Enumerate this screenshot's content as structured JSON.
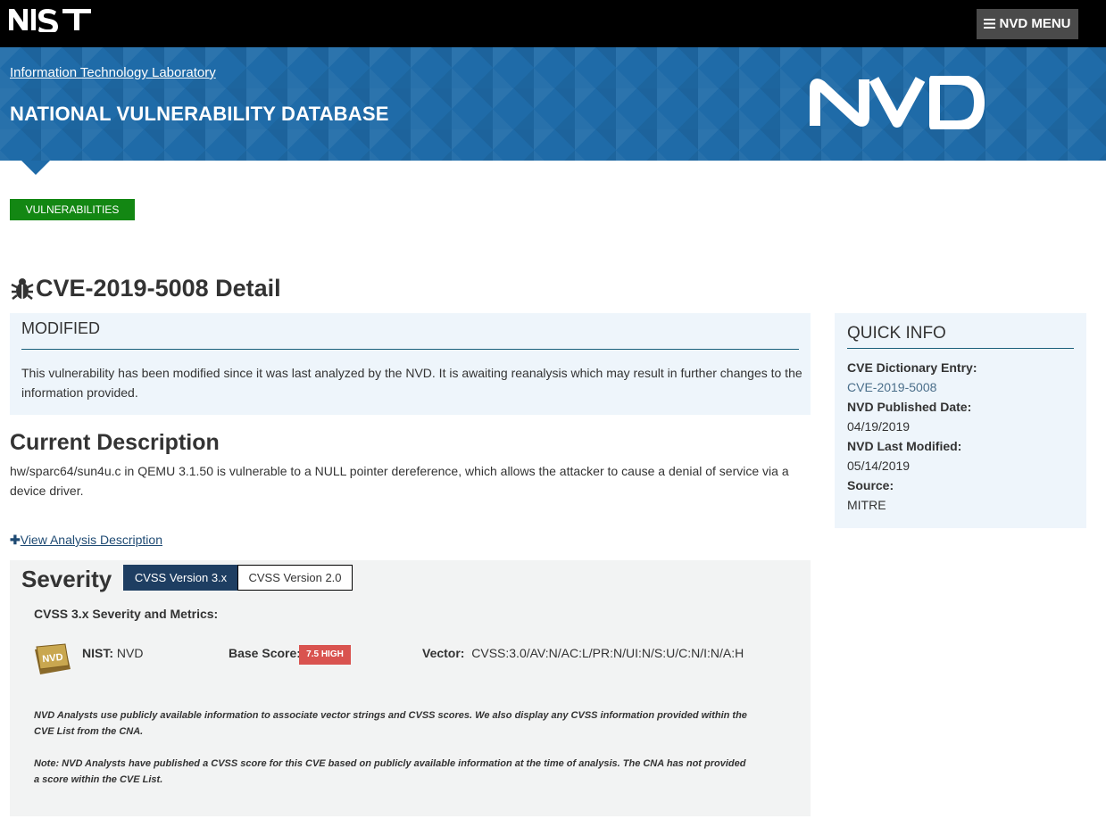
{
  "header": {
    "logo_text": "NIST",
    "menu_label": "NVD MENU",
    "itl_link": "Information Technology Laboratory",
    "site_title": "NATIONAL VULNERABILITY DATABASE",
    "nvd_logo_text": "NVD"
  },
  "breadcrumb": {
    "vulnerabilities_label": "VULNERABILITIES"
  },
  "page": {
    "title": "CVE-2019-5008 Detail"
  },
  "modified": {
    "heading": "MODIFIED",
    "text": "This vulnerability has been modified since it was last analyzed by the NVD. It is awaiting reanalysis which may result in further changes to the information provided."
  },
  "description": {
    "heading": "Current Description",
    "text": "hw/sparc64/sun4u.c in QEMU 3.1.50 is vulnerable to a NULL pointer dereference, which allows the attacker to cause a denial of service via a device driver.",
    "view_analysis": "View Analysis Description"
  },
  "severity": {
    "heading": "Severity",
    "tabs": [
      "CVSS Version 3.x",
      "CVSS Version 2.0"
    ],
    "active_tab": 0,
    "metrics_heading": "CVSS 3.x Severity and Metrics:",
    "badge_text": "NVD",
    "nist_label": "NIST:",
    "nist_value": "NVD",
    "base_score_label": "Base Score:",
    "base_score_value": "7.5 HIGH",
    "vector_label": "Vector:",
    "vector_value": "CVSS:3.0/AV:N/AC:L/PR:N/UI:N/S:U/C:N/I:N/A:H",
    "note1": "NVD Analysts use publicly available information to associate vector strings and CVSS scores. We also display any CVSS information provided within the CVE List from the CNA.",
    "note2": "Note: NVD Analysts have published a CVSS score for this CVE based on publicly available information at the time of analysis. The CNA has not provided a score within the CVE List."
  },
  "quick_info": {
    "heading": "QUICK INFO",
    "cve_entry_label": "CVE Dictionary Entry:",
    "cve_entry_value": "CVE-2019-5008",
    "published_label": "NVD Published Date:",
    "published_value": "04/19/2019",
    "modified_label": "NVD Last Modified:",
    "modified_value": "05/14/2019",
    "source_label": "Source:",
    "source_value": "MITRE"
  },
  "colors": {
    "banner": "#1f6ba8",
    "vulnerabilities_green": "#138713",
    "severity_high": "#d9534f",
    "active_tab": "#1e3e62"
  }
}
